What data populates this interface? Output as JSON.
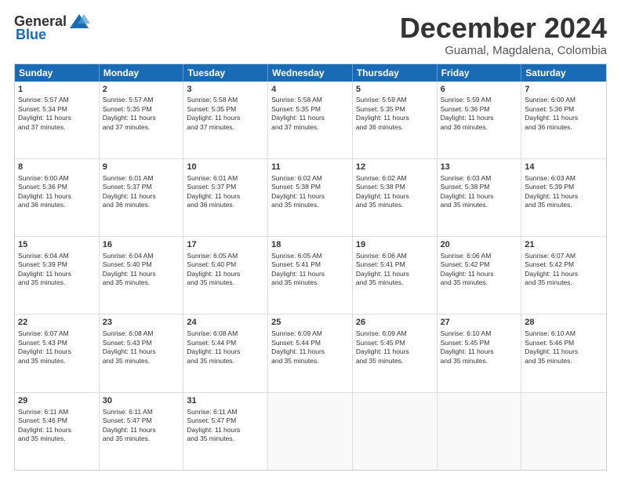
{
  "header": {
    "logo_general": "General",
    "logo_blue": "Blue",
    "month_title": "December 2024",
    "location": "Guamal, Magdalena, Colombia"
  },
  "days_of_week": [
    "Sunday",
    "Monday",
    "Tuesday",
    "Wednesday",
    "Thursday",
    "Friday",
    "Saturday"
  ],
  "weeks": [
    [
      {
        "day": "1",
        "lines": [
          "Sunrise: 5:57 AM",
          "Sunset: 5:34 PM",
          "Daylight: 11 hours",
          "and 37 minutes."
        ]
      },
      {
        "day": "2",
        "lines": [
          "Sunrise: 5:57 AM",
          "Sunset: 5:35 PM",
          "Daylight: 11 hours",
          "and 37 minutes."
        ]
      },
      {
        "day": "3",
        "lines": [
          "Sunrise: 5:58 AM",
          "Sunset: 5:35 PM",
          "Daylight: 11 hours",
          "and 37 minutes."
        ]
      },
      {
        "day": "4",
        "lines": [
          "Sunrise: 5:58 AM",
          "Sunset: 5:35 PM",
          "Daylight: 11 hours",
          "and 37 minutes."
        ]
      },
      {
        "day": "5",
        "lines": [
          "Sunrise: 5:59 AM",
          "Sunset: 5:35 PM",
          "Daylight: 11 hours",
          "and 36 minutes."
        ]
      },
      {
        "day": "6",
        "lines": [
          "Sunrise: 5:59 AM",
          "Sunset: 5:36 PM",
          "Daylight: 11 hours",
          "and 36 minutes."
        ]
      },
      {
        "day": "7",
        "lines": [
          "Sunrise: 6:00 AM",
          "Sunset: 5:36 PM",
          "Daylight: 11 hours",
          "and 36 minutes."
        ]
      }
    ],
    [
      {
        "day": "8",
        "lines": [
          "Sunrise: 6:00 AM",
          "Sunset: 5:36 PM",
          "Daylight: 11 hours",
          "and 36 minutes."
        ]
      },
      {
        "day": "9",
        "lines": [
          "Sunrise: 6:01 AM",
          "Sunset: 5:37 PM",
          "Daylight: 11 hours",
          "and 36 minutes."
        ]
      },
      {
        "day": "10",
        "lines": [
          "Sunrise: 6:01 AM",
          "Sunset: 5:37 PM",
          "Daylight: 11 hours",
          "and 36 minutes."
        ]
      },
      {
        "day": "11",
        "lines": [
          "Sunrise: 6:02 AM",
          "Sunset: 5:38 PM",
          "Daylight: 11 hours",
          "and 35 minutes."
        ]
      },
      {
        "day": "12",
        "lines": [
          "Sunrise: 6:02 AM",
          "Sunset: 5:38 PM",
          "Daylight: 11 hours",
          "and 35 minutes."
        ]
      },
      {
        "day": "13",
        "lines": [
          "Sunrise: 6:03 AM",
          "Sunset: 5:38 PM",
          "Daylight: 11 hours",
          "and 35 minutes."
        ]
      },
      {
        "day": "14",
        "lines": [
          "Sunrise: 6:03 AM",
          "Sunset: 5:39 PM",
          "Daylight: 11 hours",
          "and 35 minutes."
        ]
      }
    ],
    [
      {
        "day": "15",
        "lines": [
          "Sunrise: 6:04 AM",
          "Sunset: 5:39 PM",
          "Daylight: 11 hours",
          "and 35 minutes."
        ]
      },
      {
        "day": "16",
        "lines": [
          "Sunrise: 6:04 AM",
          "Sunset: 5:40 PM",
          "Daylight: 11 hours",
          "and 35 minutes."
        ]
      },
      {
        "day": "17",
        "lines": [
          "Sunrise: 6:05 AM",
          "Sunset: 5:40 PM",
          "Daylight: 11 hours",
          "and 35 minutes."
        ]
      },
      {
        "day": "18",
        "lines": [
          "Sunrise: 6:05 AM",
          "Sunset: 5:41 PM",
          "Daylight: 11 hours",
          "and 35 minutes."
        ]
      },
      {
        "day": "19",
        "lines": [
          "Sunrise: 6:06 AM",
          "Sunset: 5:41 PM",
          "Daylight: 11 hours",
          "and 35 minutes."
        ]
      },
      {
        "day": "20",
        "lines": [
          "Sunrise: 6:06 AM",
          "Sunset: 5:42 PM",
          "Daylight: 11 hours",
          "and 35 minutes."
        ]
      },
      {
        "day": "21",
        "lines": [
          "Sunrise: 6:07 AM",
          "Sunset: 5:42 PM",
          "Daylight: 11 hours",
          "and 35 minutes."
        ]
      }
    ],
    [
      {
        "day": "22",
        "lines": [
          "Sunrise: 6:07 AM",
          "Sunset: 5:43 PM",
          "Daylight: 11 hours",
          "and 35 minutes."
        ]
      },
      {
        "day": "23",
        "lines": [
          "Sunrise: 6:08 AM",
          "Sunset: 5:43 PM",
          "Daylight: 11 hours",
          "and 35 minutes."
        ]
      },
      {
        "day": "24",
        "lines": [
          "Sunrise: 6:08 AM",
          "Sunset: 5:44 PM",
          "Daylight: 11 hours",
          "and 35 minutes."
        ]
      },
      {
        "day": "25",
        "lines": [
          "Sunrise: 6:09 AM",
          "Sunset: 5:44 PM",
          "Daylight: 11 hours",
          "and 35 minutes."
        ]
      },
      {
        "day": "26",
        "lines": [
          "Sunrise: 6:09 AM",
          "Sunset: 5:45 PM",
          "Daylight: 11 hours",
          "and 35 minutes."
        ]
      },
      {
        "day": "27",
        "lines": [
          "Sunrise: 6:10 AM",
          "Sunset: 5:45 PM",
          "Daylight: 11 hours",
          "and 35 minutes."
        ]
      },
      {
        "day": "28",
        "lines": [
          "Sunrise: 6:10 AM",
          "Sunset: 5:46 PM",
          "Daylight: 11 hours",
          "and 35 minutes."
        ]
      }
    ],
    [
      {
        "day": "29",
        "lines": [
          "Sunrise: 6:11 AM",
          "Sunset: 5:46 PM",
          "Daylight: 11 hours",
          "and 35 minutes."
        ]
      },
      {
        "day": "30",
        "lines": [
          "Sunrise: 6:11 AM",
          "Sunset: 5:47 PM",
          "Daylight: 11 hours",
          "and 35 minutes."
        ]
      },
      {
        "day": "31",
        "lines": [
          "Sunrise: 6:11 AM",
          "Sunset: 5:47 PM",
          "Daylight: 11 hours",
          "and 35 minutes."
        ]
      },
      {
        "day": "",
        "lines": []
      },
      {
        "day": "",
        "lines": []
      },
      {
        "day": "",
        "lines": []
      },
      {
        "day": "",
        "lines": []
      }
    ]
  ]
}
